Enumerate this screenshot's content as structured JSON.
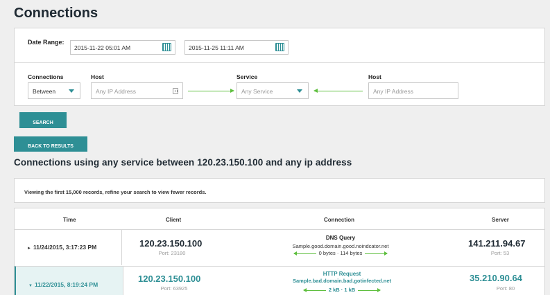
{
  "page": {
    "title": "Connections"
  },
  "search": {
    "date_range_label": "Date Range:",
    "date_start": "2015-11-22 05:01 AM",
    "date_end": "2015-11-25 11:11 AM",
    "connections_label": "Connections",
    "connections_value": "Between",
    "host1_label": "Host",
    "host1_placeholder": "Any IP Address",
    "service_label": "Service",
    "service_value": "Any Service",
    "host2_label": "Host",
    "host2_placeholder": "Any IP Address",
    "search_button": "SEARCH"
  },
  "results": {
    "back_button": "BACK TO RESULTS",
    "title": "Connections using any service between 120.23.150.100 and any ip address",
    "notice": "Viewing the first 15,000 records, refine your search to view fewer records.",
    "columns": {
      "time": "Time",
      "client": "Client",
      "connection": "Connection",
      "server": "Server"
    },
    "rows": [
      {
        "expander": "►",
        "time": "11/24/2015, 3:17:23 PM",
        "client_ip": "120.23.150.100",
        "client_port": "Port: 23180",
        "conn_type": "DNS Query",
        "conn_domain": "Sample.good.domain.good.noindcator.net",
        "bytes_out": "0 bytes",
        "bytes_sep": "·",
        "bytes_in": "114 bytes",
        "server_ip": "141.211.94.67",
        "server_port": "Port: 53"
      },
      {
        "expander": "▼",
        "time": "11/22/2015, 8:19:24 PM",
        "client_ip": "120.23.150.100",
        "client_port": "Port: 63925",
        "conn_type": "HTTP Request",
        "conn_domain": "Sample.bad.domain.bad.gotinfected.net",
        "bytes_out": "2 kB",
        "bytes_sep": "·",
        "bytes_in": "1 kB",
        "server_ip": "35.210.90.64",
        "server_port": "Port: 80"
      }
    ]
  },
  "colors": {
    "accent": "#2e8f95",
    "arrow": "#5fbf3f",
    "background": "#efefef"
  }
}
